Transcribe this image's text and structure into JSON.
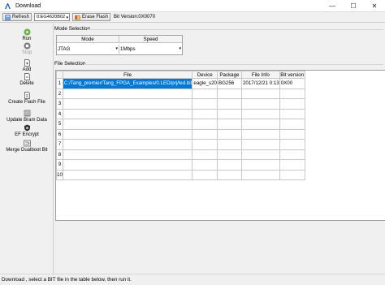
{
  "window": {
    "title": "Download",
    "minimize": "—",
    "maximize": "☐",
    "close": "✕"
  },
  "toolbar": {
    "refresh_label": "Refresh",
    "device_combo": "0:EG4620B02",
    "erase_label": "Erase Flash",
    "bit_version": "Bit Version:0X0070"
  },
  "sidebar": {
    "run": "Run",
    "stop": "Stop",
    "add": "Add",
    "delete": "Delete",
    "create_flash": "Create Flash File",
    "update_bram": "Update Bram Data",
    "ef_encrypt": "EF Encrypt",
    "merge_dualboot": "Merge Dualboot Bit"
  },
  "mode_selection": {
    "label": "Mode Selection",
    "col_mode": "Mode",
    "col_speed": "Speed",
    "mode_value": "JTAG",
    "speed_value": "1Mbps"
  },
  "file_selection": {
    "label": "File Selection",
    "columns": {
      "file": "File",
      "device": "Device",
      "package": "Package",
      "info": "File Info",
      "bitver": "Bit version"
    },
    "row_numbers": [
      "1",
      "2",
      "3",
      "4",
      "5",
      "6",
      "7",
      "8",
      "9",
      "10"
    ],
    "row1": {
      "file": "C:/Tang_premier/Tang_FPGA_Examples/0.LED/prj/led.bit",
      "device": "eagle_s20",
      "package": "BG256",
      "info": "2017/12/21 0:13",
      "bitver": "0X00"
    }
  },
  "status": {
    "text": "Download , select a BIT file in the table below, then run it."
  },
  "colors": {
    "selection": "#0078d7",
    "run_icon": "#6ab04c"
  }
}
